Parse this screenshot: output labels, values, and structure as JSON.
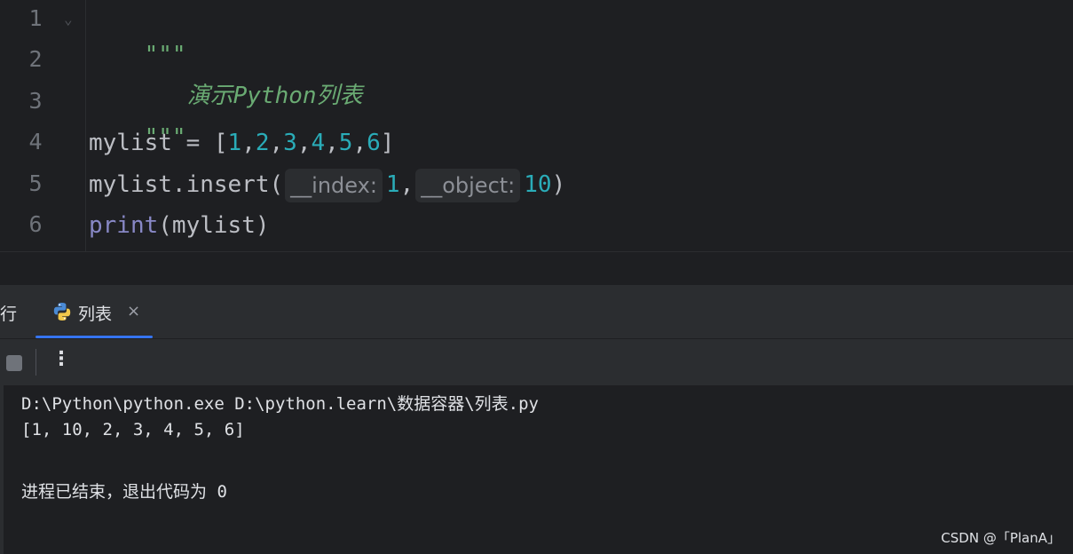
{
  "editor": {
    "line_numbers": [
      "1",
      "2",
      "3",
      "4",
      "5",
      "6"
    ],
    "line1": "\"\"\"",
    "line2": "演示Python列表",
    "line3": "\"\"\"",
    "line4": {
      "ident": "mylist",
      "op": " = [",
      "nums": [
        "1",
        "2",
        "3",
        "4",
        "5",
        "6"
      ],
      "close": "]"
    },
    "line5": {
      "prefix": "mylist.insert(",
      "hint_index": "__index:",
      "arg1": "1",
      "comma": ",",
      "hint_object": "__object:",
      "arg2": "10",
      "close": ")"
    },
    "line6": {
      "func": "print",
      "args": "(mylist)"
    }
  },
  "panel": {
    "run_tab_label": "行",
    "tab_label": "列表",
    "tab_close": "×",
    "more_label": "⋮"
  },
  "console": {
    "line1": "D:\\Python\\python.exe D:\\python.learn\\数据容器\\列表.py",
    "line2": "[1, 10, 2, 3, 4, 5, 6]",
    "line3": "进程已结束，退出代码为 0"
  },
  "watermark": "CSDN @「PlanA」",
  "colors": {
    "background": "#1e1f22",
    "string": "#6aab73",
    "number": "#2aacb8",
    "builtin": "#8888c6",
    "tab_underline": "#3574f0"
  }
}
